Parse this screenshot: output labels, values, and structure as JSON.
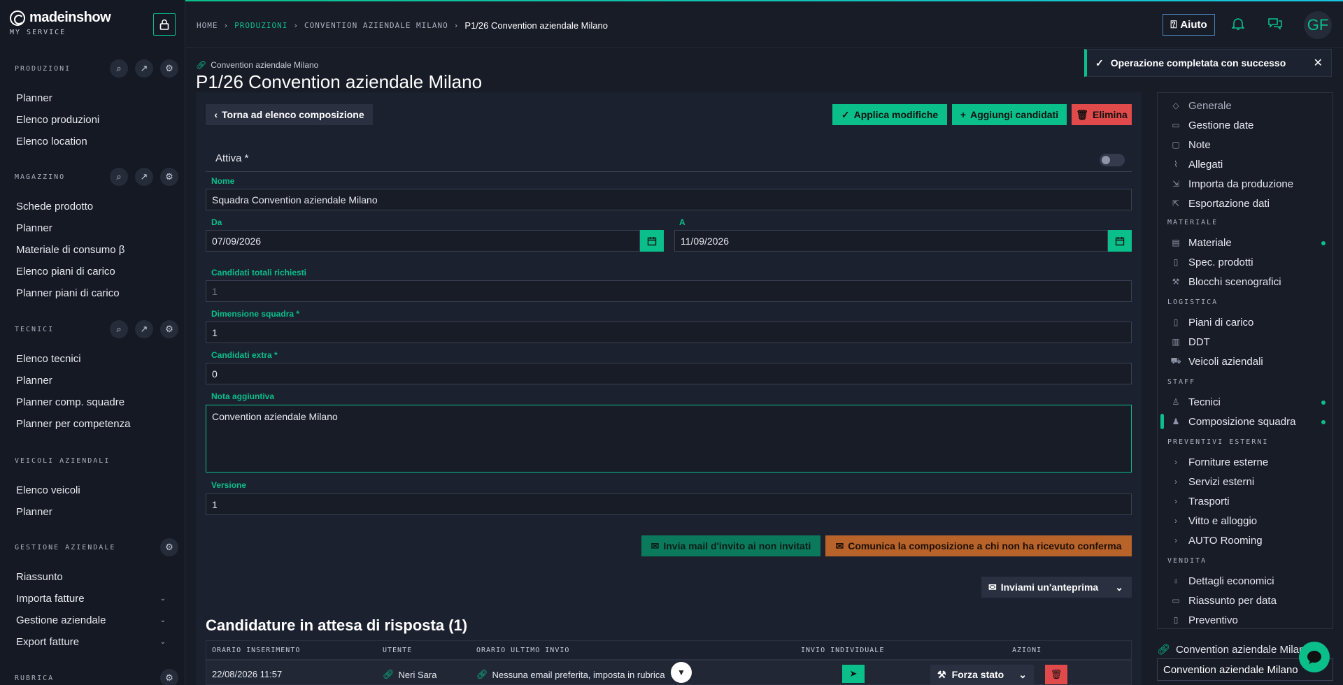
{
  "brand": {
    "name": "madeinshow",
    "sub": "MY SERVICE"
  },
  "sidebar": {
    "sections": [
      {
        "label": "PRODUZIONI",
        "items": [
          "Planner",
          "Elenco produzioni",
          "Elenco location"
        ]
      },
      {
        "label": "MAGAZZINO",
        "items": [
          "Schede prodotto",
          "Planner",
          "Materiale di consumo β",
          "Elenco piani di carico",
          "Planner piani di carico"
        ]
      },
      {
        "label": "TECNICI",
        "items": [
          "Elenco tecnici",
          "Planner",
          "Planner comp. squadre",
          "Planner per competenza"
        ]
      },
      {
        "label": "VEICOLI AZIENDALI",
        "items": [
          "Elenco veicoli",
          "Planner"
        ]
      },
      {
        "label": "GESTIONE AZIENDALE",
        "items": [
          "Riassunto",
          "Importa fatture",
          "Gestione aziendale",
          "Export fatture"
        ]
      },
      {
        "label": "RUBRICA",
        "items": []
      }
    ]
  },
  "breadcrumb": {
    "home": "HOME",
    "produzioni": "PRODUZIONI",
    "convention": "CONVENTION AZIENDALE MILANO",
    "current": "P1/26 Convention aziendale Milano"
  },
  "topbar": {
    "help": "Aiuto",
    "avatar": "GF"
  },
  "toast": {
    "message": "Operazione completata con successo"
  },
  "page": {
    "parent_link": "Convention aziendale Milano",
    "title": "P1/26 Convention aziendale Milano"
  },
  "actions": {
    "back": "Torna ad elenco composizione",
    "apply": "Applica modifiche",
    "add": "Aggiungi candidati",
    "delete": "Elimina"
  },
  "form": {
    "active_label": "Attiva *",
    "nome_label": "Nome",
    "nome_value": "Squadra Convention aziendale Milano",
    "da_label": "Da",
    "da_value": "07/09/2026",
    "a_label": "A",
    "a_value": "11/09/2026",
    "candidati_totali_label": "Candidati totali richiesti",
    "candidati_totali_value": "1",
    "dimensione_label": "Dimensione squadra *",
    "dimensione_value": "1",
    "extra_label": "Candidati extra *",
    "extra_value": "0",
    "nota_label": "Nota aggiuntiva",
    "nota_value": "Convention aziendale Milano",
    "versione_label": "Versione",
    "versione_value": "1"
  },
  "mail_actions": {
    "invite": "Invia mail d'invito ai non invitati",
    "communicate": "Comunica la composizione a chi non ha ricevuto conferma",
    "preview": "Inviami un'anteprima"
  },
  "pending": {
    "title": "Candidature in attesa di risposta (1)",
    "columns": [
      "ORARIO INSERIMENTO",
      "UTENTE",
      "ORARIO ULTIMO INVIO",
      "INVIO INDIVIDUALE",
      "AZIONI"
    ],
    "rows": [
      {
        "inserted": "22/08/2026 11:57",
        "user": "Neri Sara",
        "last_sent": "Nessuna email preferita, imposta in rubrica",
        "force": "Forza stato"
      }
    ]
  },
  "right_nav": {
    "general": [
      "Generale",
      "Gestione date",
      "Note",
      "Allegati",
      "Importa da produzione",
      "Esportazione dati"
    ],
    "materiale_head": "MATERIALE",
    "materiale": [
      "Materiale",
      "Spec. prodotti",
      "Blocchi scenografici"
    ],
    "logistica_head": "LOGISTICA",
    "logistica": [
      "Piani di carico",
      "DDT",
      "Veicoli aziendali"
    ],
    "staff_head": "STAFF",
    "staff": [
      "Tecnici",
      "Composizione squadra"
    ],
    "preventivi_head": "PREVENTIVI ESTERNI",
    "preventivi": [
      "Forniture esterne",
      "Servizi esterni",
      "Trasporti",
      "Vitto e alloggio",
      "AUTO Rooming"
    ],
    "vendita_head": "VENDITA",
    "vendita": [
      "Dettagli economici",
      "Riassunto per data",
      "Preventivo"
    ]
  },
  "footer_selector": {
    "label": "Convention aziendale Milano",
    "value": "Convention aziendale Milano"
  },
  "colors": {
    "accent": "#0bbf8a",
    "danger": "#e14a4a",
    "warning": "#b7632a",
    "bg": "#181c27"
  }
}
